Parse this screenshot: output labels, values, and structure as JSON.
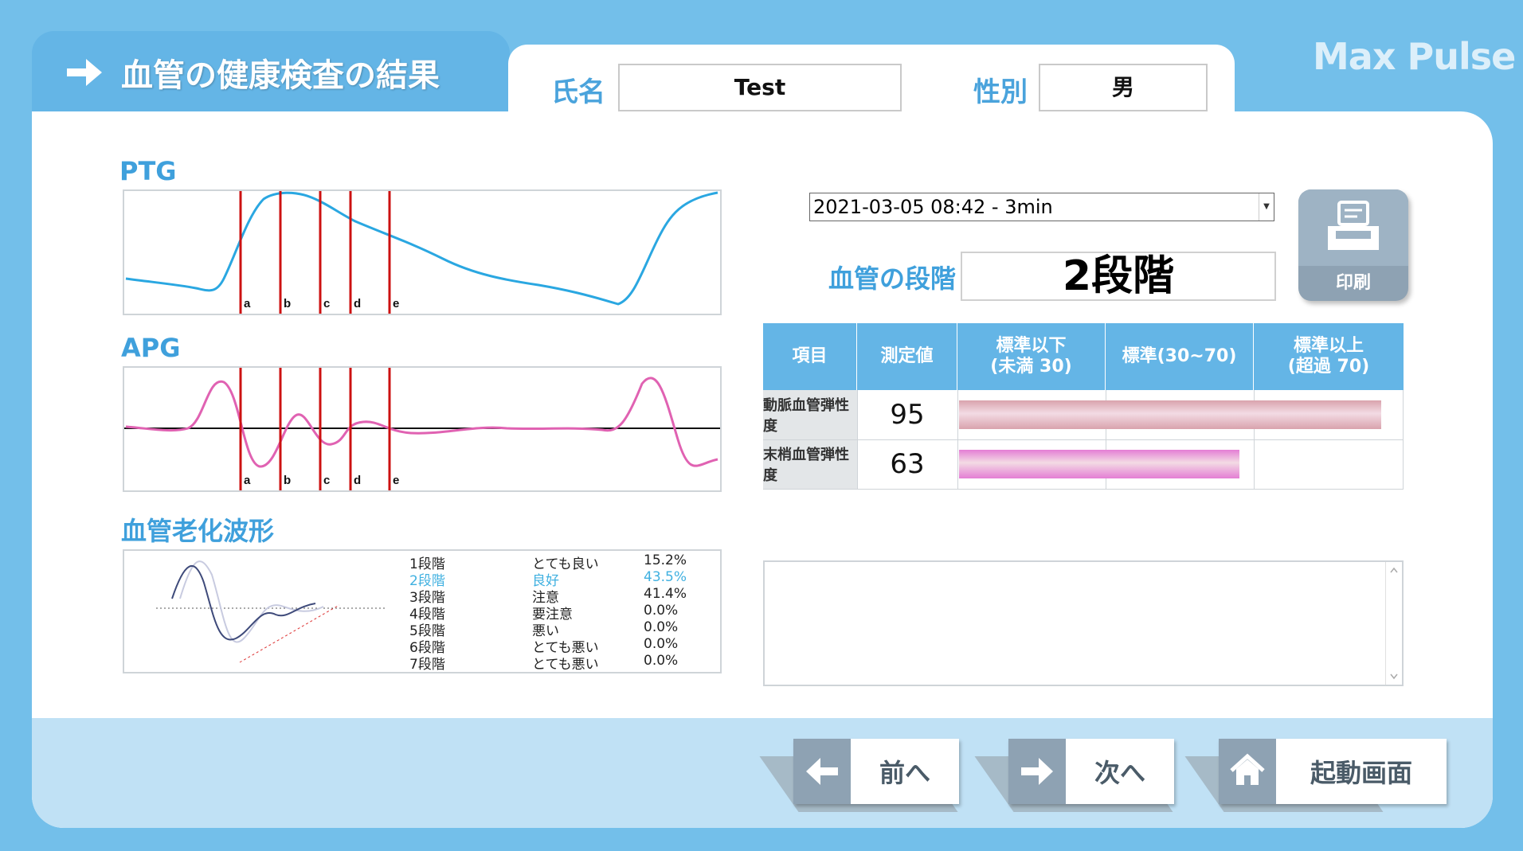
{
  "header": {
    "title": "血管の健康検査の結果",
    "brand": "Max Pulse",
    "name_label": "氏名",
    "name_value": "Test",
    "gender_label": "性別",
    "gender_value": "男"
  },
  "charts": {
    "ptg_title": "PTG",
    "apg_title": "APG",
    "aging_title": "血管老化波形",
    "markers": [
      "a",
      "b",
      "c",
      "d",
      "e"
    ]
  },
  "aging_table": [
    {
      "stage": "1段階",
      "grade": "とても良い",
      "pct": "15.2%",
      "highlight": false
    },
    {
      "stage": "2段階",
      "grade": "良好",
      "pct": "43.5%",
      "highlight": true
    },
    {
      "stage": "3段階",
      "grade": "注意",
      "pct": "41.4%",
      "highlight": false
    },
    {
      "stage": "4段階",
      "grade": "要注意",
      "pct": "0.0%",
      "highlight": false
    },
    {
      "stage": "5段階",
      "grade": "悪い",
      "pct": "0.0%",
      "highlight": false
    },
    {
      "stage": "6段階",
      "grade": "とても悪い",
      "pct": "0.0%",
      "highlight": false
    },
    {
      "stage": "7段階",
      "grade": "とても悪い",
      "pct": "0.0%",
      "highlight": false
    }
  ],
  "measurement": {
    "selected_session": "2021-03-05 08:42 - 3min",
    "print_label": "印刷",
    "stage_label": "血管の段階",
    "stage_value": "2段階"
  },
  "elasticity_table": {
    "headers": {
      "item": "項目",
      "value": "測定値",
      "below_line1": "標準以下",
      "below_line2": "(未満 30)",
      "normal": "標準(30~70)",
      "above_line1": "標準以上",
      "above_line2": "(超過 70)"
    },
    "rows": [
      {
        "label": "動脈血管弾性度",
        "value": 95,
        "bar_color": "#d9a3ad"
      },
      {
        "label": "末梢血管弾性度",
        "value": 63,
        "bar_color": "#e47ed4"
      }
    ]
  },
  "nav": {
    "prev_label": "前へ",
    "next_label": "次へ",
    "home_label": "起動画面"
  },
  "colors": {
    "accent": "#64b5e6",
    "ptg_line": "#2aa7e1",
    "apg_line": "#e062b2",
    "marker_line": "#cc1111"
  }
}
